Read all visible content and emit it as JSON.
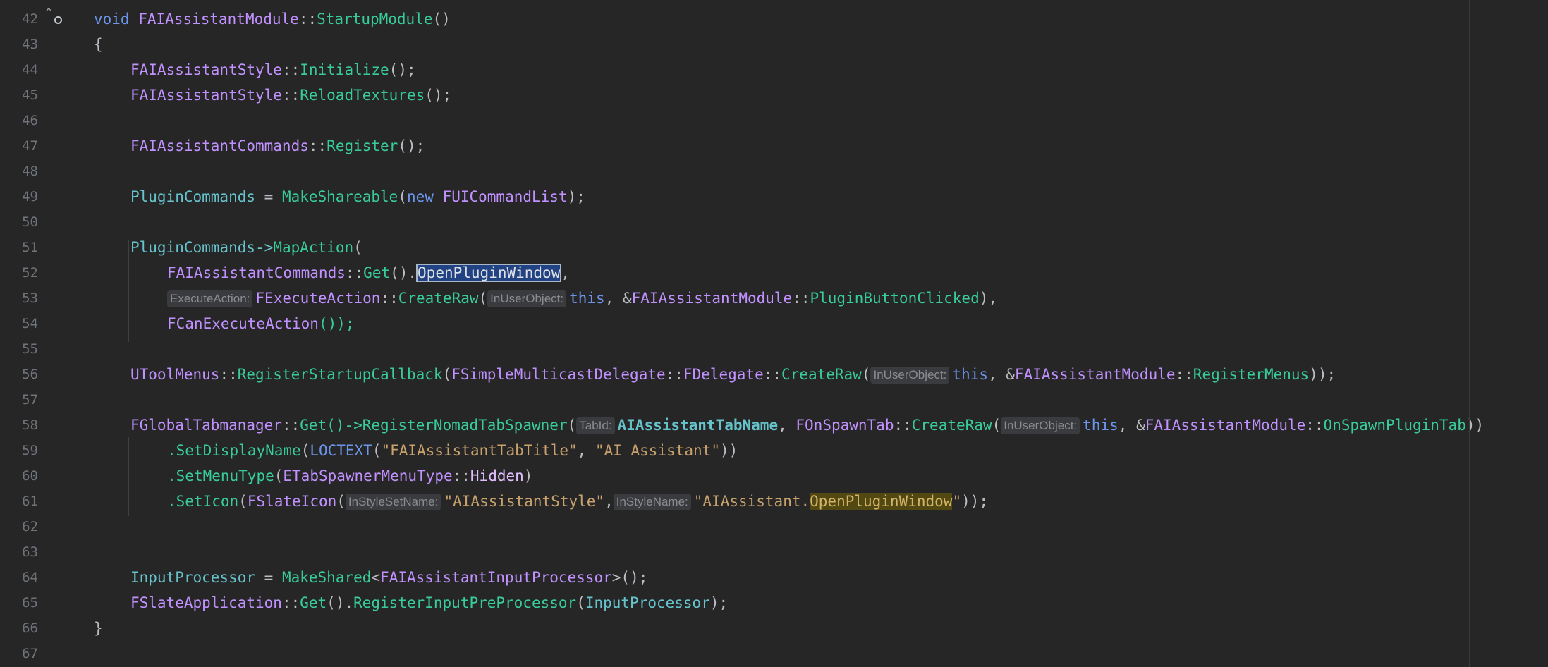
{
  "editor": {
    "line_numbers": [
      "42",
      "43",
      "44",
      "45",
      "46",
      "47",
      "48",
      "49",
      "50",
      "51",
      "52",
      "53",
      "54",
      "55",
      "56",
      "57",
      "58",
      "59",
      "60",
      "61",
      "62",
      "63",
      "64",
      "65",
      "66",
      "67"
    ],
    "fold_marker": "^",
    "colors": {
      "background": "#262626",
      "keyword": "#6c95eb",
      "class": "#c191ff",
      "function": "#39cc9b",
      "variable": "#66c3cc",
      "string": "#c9a26d",
      "text": "#bcbec4"
    }
  },
  "code": {
    "l42": {
      "kw_void": "void",
      "cls": "FAIAssistantModule",
      "sep": "::",
      "fn": "StartupModule",
      "tail": "()"
    },
    "l43": {
      "brace": "{"
    },
    "l44": {
      "cls": "FAIAssistantStyle",
      "sep": "::",
      "fn": "Initialize",
      "tail": "();"
    },
    "l45": {
      "cls": "FAIAssistantStyle",
      "sep": "::",
      "fn": "ReloadTextures",
      "tail": "();"
    },
    "l47": {
      "cls": "FAIAssistantCommands",
      "sep": "::",
      "fn": "Register",
      "tail": "();"
    },
    "l49": {
      "var": "PluginCommands",
      "eq": " = ",
      "fn": "MakeShareable",
      "open": "(",
      "kw_new": "new",
      "cls": "FUICommandList",
      "tail": ");"
    },
    "l51": {
      "var": "PluginCommands",
      "arrow": "->",
      "fn": "MapAction",
      "open": "("
    },
    "l52": {
      "cls": "FAIAssistantCommands",
      "sep": "::",
      "fn": "Get",
      "mid": "().",
      "selected": "OpenPluginWindow",
      "tail": ","
    },
    "l53": {
      "hint1": "ExecuteAction:",
      "cls": "FExecuteAction",
      "sep": "::",
      "fn": "CreateRaw",
      "open": "(",
      "hint2": "InUserObject:",
      "kw_this": "this",
      "comma": ", &",
      "cls2": "FAIAssistantModule",
      "sep2": "::",
      "fn2": "PluginButtonClicked",
      "tail": "),"
    },
    "l54": {
      "cls": "FCanExecuteAction",
      "tail": "());"
    },
    "l56": {
      "cls": "UToolMenus",
      "sep": "::",
      "fn": "RegisterStartupCallback",
      "open": "(",
      "cls2": "FSimpleMulticastDelegate",
      "sep2": "::",
      "cls3": "FDelegate",
      "sep3": "::",
      "fn2": "CreateRaw",
      "open2": "(",
      "hint": "InUserObject:",
      "kw_this": "this",
      "comma": ", &",
      "cls4": "FAIAssistantModule",
      "sep4": "::",
      "fn3": "RegisterMenus",
      "tail": "));"
    },
    "l58": {
      "cls": "FGlobalTabmanager",
      "sep": "::",
      "fn": "Get",
      "mid": "()->",
      "fn2": "RegisterNomadTabSpawner",
      "open": "(",
      "hint1": "TabId:",
      "var": "AIAssistantTabName",
      "comma": ", ",
      "cls2": "FOnSpawnTab",
      "sep2": "::",
      "fn3": "CreateRaw",
      "open2": "(",
      "hint2": "InUserObject:",
      "kw_this": "this",
      "comma2": ", &",
      "cls3": "FAIAssistantModule",
      "sep3": "::",
      "fn4": "OnSpawnPluginTab",
      "tail": "))"
    },
    "l59": {
      "dot": ".",
      "fn": "SetDisplayName",
      "open": "(",
      "mac": "LOCTEXT",
      "open2": "(",
      "str1": "\"FAIAssistantTabTitle\"",
      "comma": ", ",
      "str2": "\"AI Assistant\"",
      "tail": "))"
    },
    "l60": {
      "dot": ".",
      "fn": "SetMenuType",
      "open": "(",
      "cls": "ETabSpawnerMenuType",
      "sep": "::",
      "enm": "Hidden",
      "tail": ")"
    },
    "l61": {
      "dot": ".",
      "fn": "SetIcon",
      "open": "(",
      "cls": "FSlateIcon",
      "open2": "(",
      "hint1": "InStyleSetName:",
      "str1": "\"AIAssistantStyle\"",
      "comma": ",",
      "hint2": "InStyleName:",
      "str2a": "\"AIAssistant.",
      "str2hl": "OpenPluginWindow",
      "str2b": "\"",
      "tail": "));"
    },
    "l64": {
      "var": "InputProcessor",
      "eq": " = ",
      "fn": "MakeShared",
      "lt": "<",
      "cls": "FAIAssistantInputProcessor",
      "tail": ">();"
    },
    "l65": {
      "cls": "FSlateApplication",
      "sep": "::",
      "fn": "Get",
      "mid": "().",
      "fn2": "RegisterInputPreProcessor",
      "open": "(",
      "var": "InputProcessor",
      "tail": ");"
    },
    "l66": {
      "brace": "}"
    }
  }
}
